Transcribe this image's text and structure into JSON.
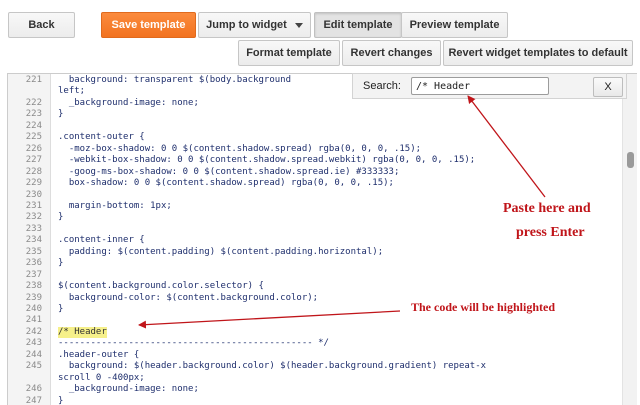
{
  "toolbar": {
    "back_label": "Back",
    "save_label": "Save template",
    "jump_label": "Jump to widget",
    "edit_label": "Edit template",
    "preview_label": "Preview template",
    "format_label": "Format template",
    "revert_label": "Revert changes",
    "revert_widget_label": "Revert widget templates to default"
  },
  "search": {
    "label": "Search:",
    "value": "/* Header",
    "close_label": "X"
  },
  "editor": {
    "lines": [
      {
        "num": "221",
        "code": "  background: transparent $(body.background"
      },
      {
        "num": "",
        "code": "left;"
      },
      {
        "num": "222",
        "code": "  _background-image: none;"
      },
      {
        "num": "223",
        "code": "}"
      },
      {
        "num": "224",
        "code": ""
      },
      {
        "num": "225",
        "code": ".content-outer {"
      },
      {
        "num": "226",
        "code": "  -moz-box-shadow: 0 0 $(content.shadow.spread) rgba(0, 0, 0, .15);"
      },
      {
        "num": "227",
        "code": "  -webkit-box-shadow: 0 0 $(content.shadow.spread.webkit) rgba(0, 0, 0, .15);"
      },
      {
        "num": "228",
        "code": "  -goog-ms-box-shadow: 0 0 $(content.shadow.spread.ie) #333333;"
      },
      {
        "num": "229",
        "code": "  box-shadow: 0 0 $(content.shadow.spread) rgba(0, 0, 0, .15);"
      },
      {
        "num": "230",
        "code": ""
      },
      {
        "num": "231",
        "code": "  margin-bottom: 1px;"
      },
      {
        "num": "232",
        "code": "}"
      },
      {
        "num": "233",
        "code": ""
      },
      {
        "num": "234",
        "code": ".content-inner {"
      },
      {
        "num": "235",
        "code": "  padding: $(content.padding) $(content.padding.horizontal);"
      },
      {
        "num": "236",
        "code": "}"
      },
      {
        "num": "237",
        "code": ""
      },
      {
        "num": "238",
        "code": "$(content.background.color.selector) {"
      },
      {
        "num": "239",
        "code": "  background-color: $(content.background.color);"
      },
      {
        "num": "240",
        "code": "}"
      },
      {
        "num": "241",
        "code": ""
      },
      {
        "num": "242",
        "code": "/* Header",
        "highlight": true
      },
      {
        "num": "243",
        "code": "----------------------------------------------- */"
      },
      {
        "num": "244",
        "code": ".header-outer {"
      },
      {
        "num": "245",
        "code": "  background: $(header.background.color) $(header.background.gradient) repeat-x"
      },
      {
        "num": "",
        "code": "scroll 0 -400px;"
      },
      {
        "num": "246",
        "code": "  _background-image: none;"
      },
      {
        "num": "247",
        "code": "}"
      }
    ]
  },
  "annotations": {
    "paste_line1": "Paste here and",
    "paste_line2": "press Enter",
    "highlight_note": "The code will be highlighted"
  },
  "colors": {
    "accent": "#f27320",
    "annotation": "#c0151a",
    "highlight": "#f6f08a"
  }
}
